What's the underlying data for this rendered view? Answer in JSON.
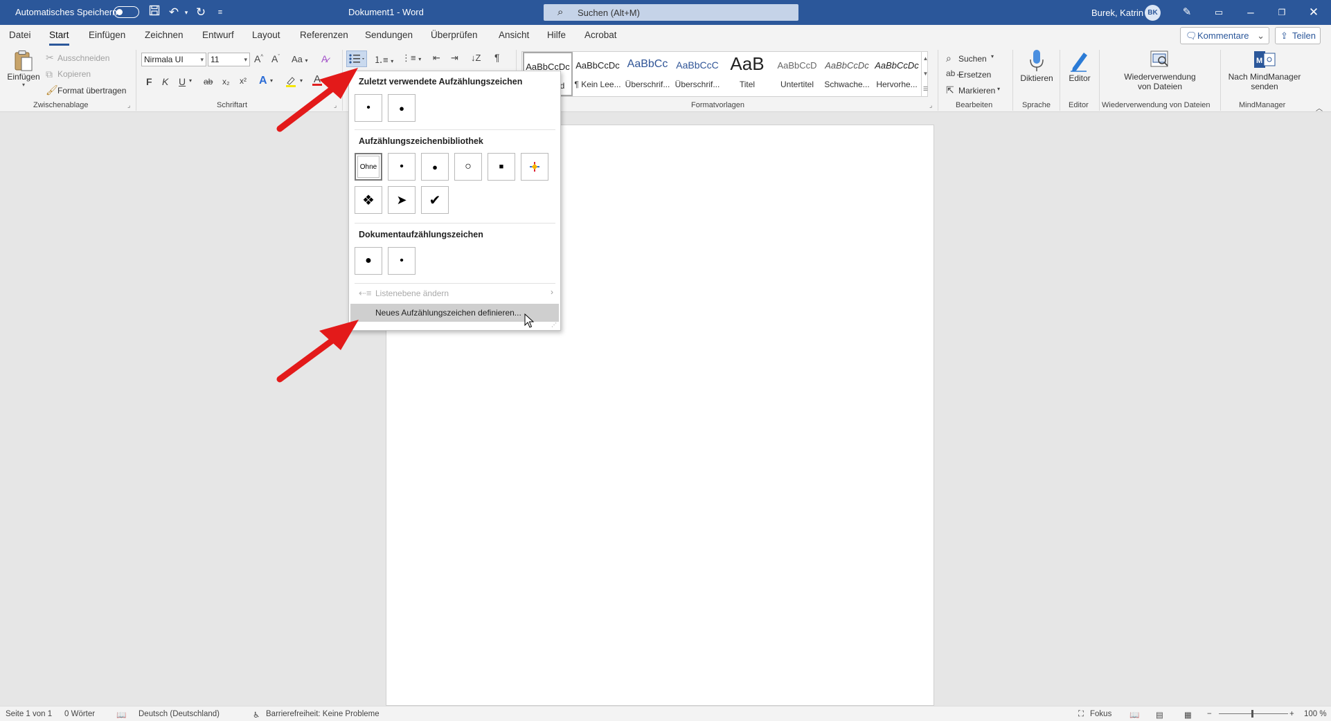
{
  "titlebar": {
    "autosave_label": "Automatisches Speichern",
    "doc_title": "Dokument1  -  Word",
    "search_placeholder": "Suchen (Alt+M)",
    "user_name": "Burek, Katrin",
    "avatar_initials": "BK"
  },
  "menu": {
    "tabs": [
      "Datei",
      "Start",
      "Einfügen",
      "Zeichnen",
      "Entwurf",
      "Layout",
      "Referenzen",
      "Sendungen",
      "Überprüfen",
      "Ansicht",
      "Hilfe",
      "Acrobat"
    ],
    "active_tab": "Start",
    "kommentare_label": "Kommentare",
    "teilen_label": "Teilen"
  },
  "ribbon": {
    "clipboard": {
      "paste_label": "Einfügen",
      "cut_label": "Ausschneiden",
      "copy_label": "Kopieren",
      "format_painter_label": "Format übertragen",
      "group_label": "Zwischenablage"
    },
    "font": {
      "font_name": "Nirmala UI",
      "font_size": "11",
      "grow_label": "A^",
      "shrink_label": "Aˇ",
      "case_label": "Aa",
      "bold": "F",
      "italic": "K",
      "underline": "U",
      "strike": "ab",
      "sub": "x₂",
      "sup": "x²",
      "group_label": "Schriftart"
    },
    "styles": {
      "items": [
        {
          "preview": "AaBbCcDc",
          "name": "Standard"
        },
        {
          "preview": "AaBbCcDc",
          "name": "¶ Kein Lee..."
        },
        {
          "preview": "AaBbCc",
          "name": "Überschrif..."
        },
        {
          "preview": "AaBbCcC",
          "name": "Überschrif..."
        },
        {
          "preview": "AaB",
          "name": "Titel"
        },
        {
          "preview": "AaBbCcD",
          "name": "Untertitel"
        },
        {
          "preview": "AaBbCcDc",
          "name": "Schwache..."
        },
        {
          "preview": "AaBbCcDc",
          "name": "Hervorhe..."
        }
      ],
      "group_label": "Formatvorlagen"
    },
    "editing": {
      "find_label": "Suchen",
      "replace_label": "Ersetzen",
      "select_label": "Markieren",
      "group_label": "Bearbeiten"
    },
    "voice": {
      "dictate_label": "Diktieren",
      "group_label": "Sprache"
    },
    "editor": {
      "editor_label": "Editor",
      "group_label": "Editor"
    },
    "reuse": {
      "line1": "Wiederverwendung",
      "line2": "von Dateien",
      "group_label": "Wiederverwendung von Dateien"
    },
    "mindmanager": {
      "line1": "Nach MindManager",
      "line2": "senden",
      "group_label": "MindManager"
    }
  },
  "dropdown": {
    "recent_heading": "Zuletzt verwendete Aufzählungszeichen",
    "library_heading": "Aufzählungszeichenbibliothek",
    "document_heading": "Dokumentaufzählungszeichen",
    "none_label": "Ohne",
    "change_level_label": "Listenebene ändern",
    "define_new_label": "Neues Aufzählungszeichen definieren...",
    "recent_bullets": [
      "•",
      "●"
    ],
    "library_bullets": [
      "•",
      "●",
      "○",
      "■",
      "✦",
      "❖",
      "➤",
      "✔"
    ],
    "document_bullets": [
      "●",
      "•"
    ]
  },
  "statusbar": {
    "page": "Seite 1 von 1",
    "words": "0 Wörter",
    "language": "Deutsch (Deutschland)",
    "accessibility": "Barrierefreiheit: Keine Probleme",
    "focus": "Fokus",
    "zoom": "100 %"
  },
  "colors": {
    "brand": "#2b579a",
    "annotation_arrow": "#e31a1a"
  }
}
